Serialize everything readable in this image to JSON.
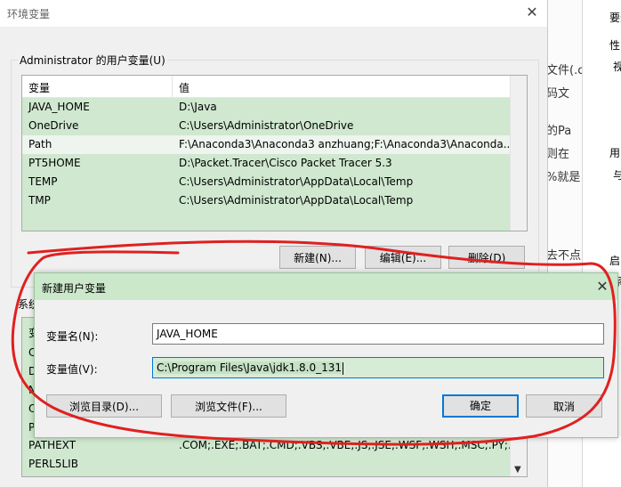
{
  "background": {
    "texts": [
      "文件(.c",
      "码文",
      "的Pa",
      "则在",
      "%就是",
      "去不点"
    ],
    "panel": {
      "labels": [
        "要选",
        "性",
        "视",
        "用",
        "与",
        "启",
        "系"
      ]
    }
  },
  "env_window": {
    "title": "环境变量",
    "user_group_label": "Administrator 的用户变量(U)",
    "columns": [
      "变量",
      "值"
    ],
    "user_vars": [
      {
        "name": "JAVA_HOME",
        "value": "D:\\Java"
      },
      {
        "name": "OneDrive",
        "value": "C:\\Users\\Administrator\\OneDrive"
      },
      {
        "name": "Path",
        "value": "F:\\Anaconda3\\Anaconda3 anzhuang;F:\\Anaconda3\\Anaconda..."
      },
      {
        "name": "PT5HOME",
        "value": "D:\\Packet.Tracer\\Cisco Packet Tracer 5.3"
      },
      {
        "name": "TEMP",
        "value": "C:\\Users\\Administrator\\AppData\\Local\\Temp"
      },
      {
        "name": "TMP",
        "value": "C:\\Users\\Administrator\\AppData\\Local\\Temp"
      }
    ],
    "buttons": {
      "new": "新建(N)...",
      "edit": "编辑(E)...",
      "delete": "删除(D)"
    },
    "sys_group_label": "系统",
    "sys_vars_partial": [
      "变",
      "C",
      "D",
      "N",
      "O",
      "P"
    ],
    "sys_vars": [
      {
        "name": "PATHEXT",
        "value": ".COM;.EXE;.BAT;.CMD;.VBS;.VBE;.JS;.JSE;.WSF;.WSH;.MSC;.PY;.P..."
      },
      {
        "name": "PERL5LIB",
        "value": ""
      }
    ]
  },
  "dialog": {
    "title": "新建用户变量",
    "name_label": "变量名(N):",
    "name_value": "JAVA_HOME",
    "value_label": "变量值(V):",
    "value_value": "C:\\Program Files\\Java\\jdk1.8.0_131",
    "browse_dir": "浏览目录(D)...",
    "browse_file": "浏览文件(F)...",
    "ok": "确定",
    "cancel": "取消"
  },
  "colors": {
    "selection": "#cfe8cf",
    "focus": "#0078d7",
    "annotation": "#e02020"
  }
}
